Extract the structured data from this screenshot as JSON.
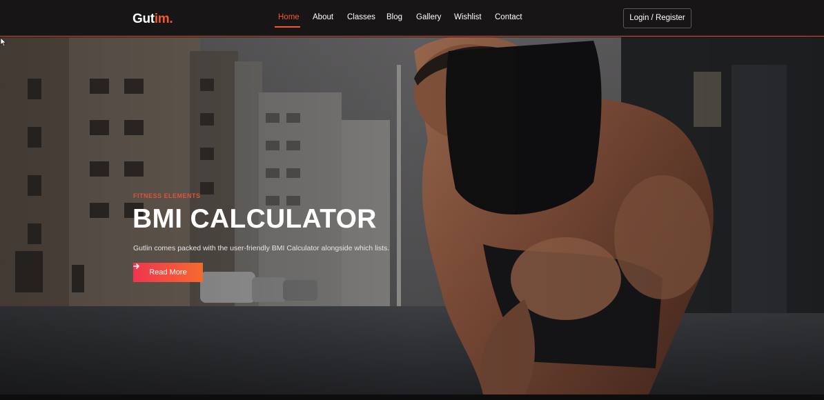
{
  "brand": {
    "part_a": "Gut",
    "part_b": "im."
  },
  "nav": {
    "items": [
      {
        "label": "Home",
        "active": true
      },
      {
        "label": "About"
      },
      {
        "label": "Classes"
      },
      {
        "label": "Blog"
      },
      {
        "label": "Gallery"
      },
      {
        "label": "Wishlist"
      },
      {
        "label": "Contact"
      }
    ],
    "login_label": "Login / Register"
  },
  "hero": {
    "subtitle": "FITNESS ELEMENTS",
    "title": "BMI CALCULATOR",
    "description": "Gutlin comes packed with the user-friendly BMI Calculator alongside which lists.",
    "button_label": "Read More",
    "button_icon": "arrow-right-icon",
    "background_image": "athlete-tying-shoe-street-photo"
  },
  "colors": {
    "accent": "#f15a29",
    "button_gradient_start": "#f2344f",
    "button_gradient_end": "#f46a2e",
    "header_bg": "#171515"
  }
}
